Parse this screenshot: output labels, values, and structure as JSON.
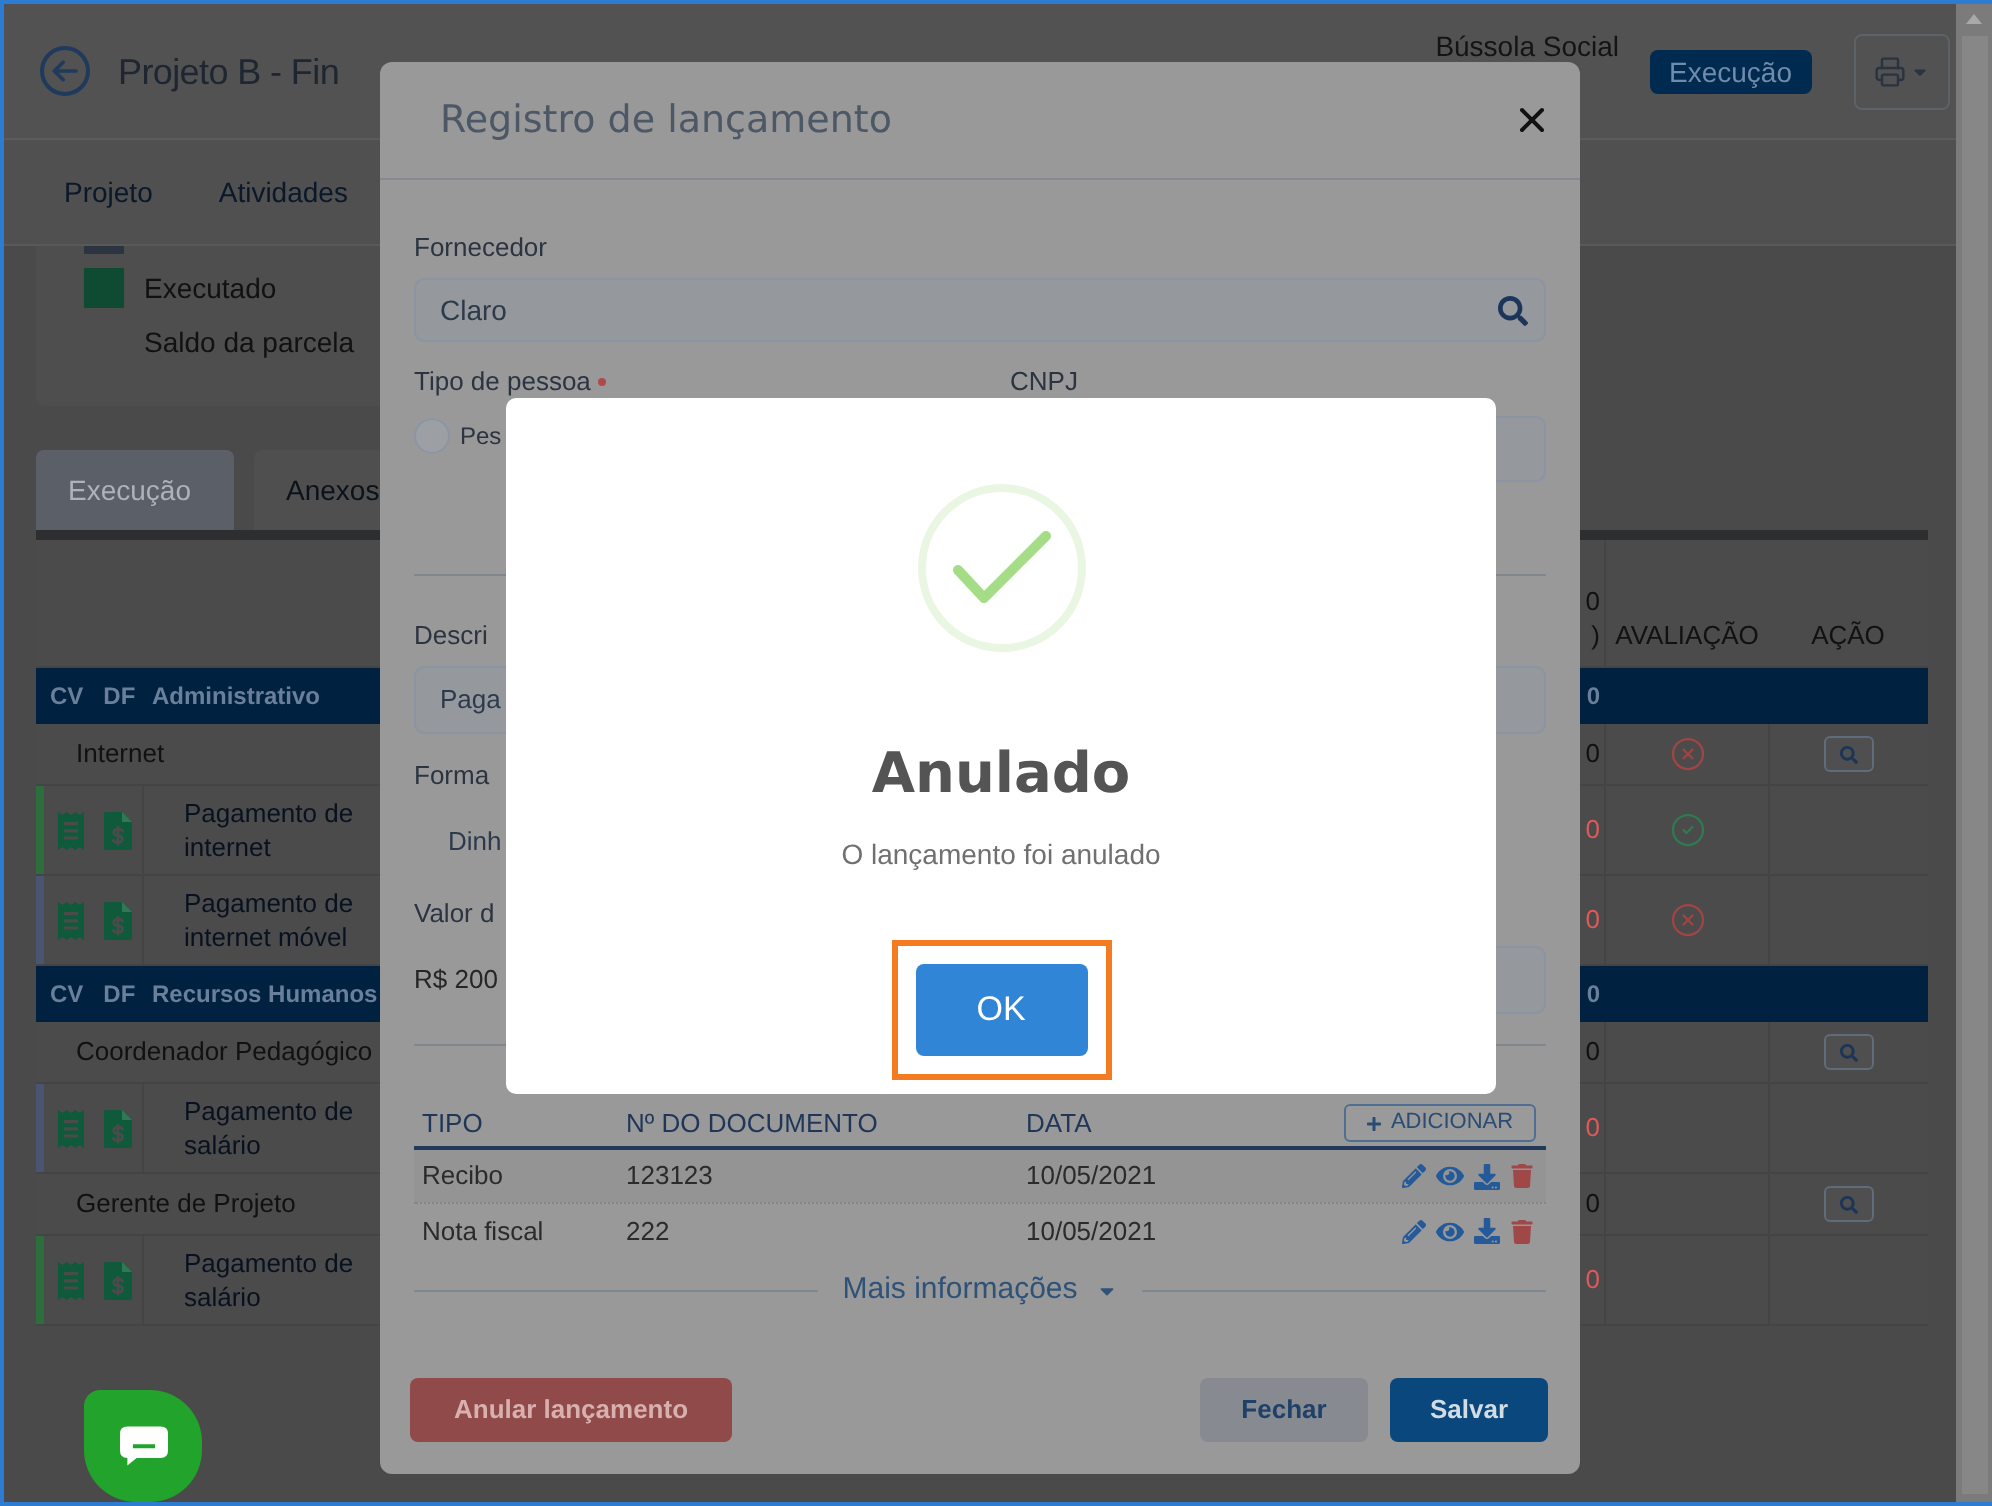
{
  "header": {
    "title": "Projeto B - Fin",
    "organization": "Bússola Social",
    "status": "Execução"
  },
  "nav": [
    {
      "label": "Projeto"
    },
    {
      "label": "Atividades"
    }
  ],
  "legend": [
    {
      "color": "#2c3440"
    },
    {
      "label": "Executado",
      "color": "#0f4a33"
    },
    {
      "label": "Saldo da parcela"
    }
  ],
  "tabs": [
    {
      "label": "Execução",
      "selected": true
    },
    {
      "label": "Anexos",
      "selected": false
    }
  ],
  "table": {
    "columns": [
      {
        "label_lines": [
          "0",
          ")"
        ]
      },
      {
        "label": "AVALIAÇÃO"
      },
      {
        "label": "AÇÃO"
      }
    ],
    "rows": [
      {
        "kind": "group",
        "codes": [
          "CV",
          "DF"
        ],
        "name": "Administrativo",
        "value": "0"
      },
      {
        "kind": "subgroup",
        "name": "Internet",
        "value": "0",
        "approved": false,
        "search_button": true
      },
      {
        "kind": "item",
        "name": "Pagamento de internet",
        "value": "0",
        "color": "#2c6e3c",
        "approved": true
      },
      {
        "kind": "item",
        "name": "Pagamento de internet móvel",
        "value": "0",
        "color": "#4a5574",
        "approved": false
      },
      {
        "kind": "group",
        "codes": [
          "CV",
          "DF"
        ],
        "name": "Recursos Humanos",
        "value": "0"
      },
      {
        "kind": "subgroup",
        "name": "Coordenador Pedagógico",
        "value": "0",
        "search_button": true
      },
      {
        "kind": "item",
        "name": "Pagamento de salário",
        "value": "0",
        "color": "#4a5574"
      },
      {
        "kind": "subgroup",
        "name": "Gerente de Projeto",
        "value": "0",
        "search_button": true
      },
      {
        "kind": "item",
        "name": "Pagamento de salário",
        "value": "0",
        "color": "#2c6e3c"
      }
    ]
  },
  "launch_modal": {
    "title": "Registro de lançamento",
    "supplier": {
      "label": "Fornecedor",
      "value": "Claro"
    },
    "person_type": {
      "label": "Tipo de pessoa",
      "required": true,
      "option": "Pes",
      "selected": false
    },
    "cnpj": {
      "label": "CNPJ"
    },
    "description": {
      "label": "Descri",
      "value": "Paga"
    },
    "payment_method": {
      "label": "Forma",
      "value": "Dinh"
    },
    "amount": {
      "label": "Valor d",
      "value": "R$ 200"
    },
    "documents": {
      "columns": [
        "TIPO",
        "Nº DO DOCUMENTO",
        "DATA"
      ],
      "add_button": "ADICIONAR",
      "rows": [
        {
          "type": "Recibo",
          "number": "123123",
          "date": "10/05/2021"
        },
        {
          "type": "Nota fiscal",
          "number": "222",
          "date": "10/05/2021"
        }
      ]
    },
    "more_info": "Mais informações",
    "buttons": {
      "void": "Anular lançamento",
      "close": "Fechar",
      "save": "Salvar"
    }
  },
  "alert": {
    "title": "Anulado",
    "message": "O lançamento foi anulado",
    "confirm": "OK",
    "highlighted": true
  }
}
